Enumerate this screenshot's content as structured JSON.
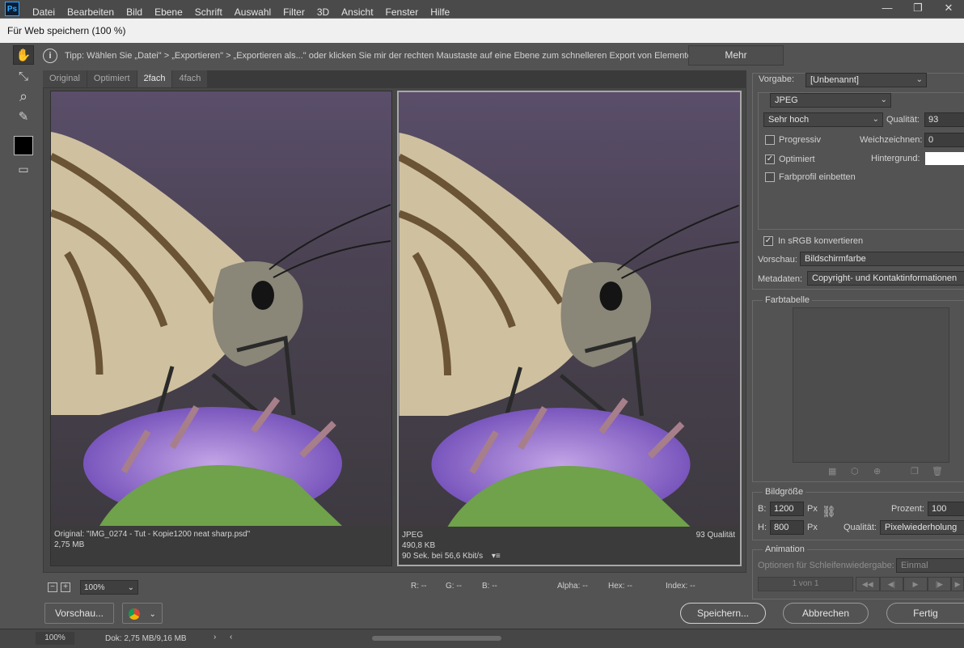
{
  "menubar": {
    "logo": "Ps",
    "items": [
      "Datei",
      "Bearbeiten",
      "Bild",
      "Ebene",
      "Schrift",
      "Auswahl",
      "Filter",
      "3D",
      "Ansicht",
      "Fenster",
      "Hilfe"
    ],
    "win_min": "—",
    "win_max": "❐",
    "win_close": "✕"
  },
  "dialog": {
    "title": "Für Web speichern (100 %)",
    "tip_icon": "i",
    "tip": "Tipp: Wählen Sie „Datei\" > „Exportieren\" > „Exportieren als...\" oder klicken Sie mir der rechten Maustaste auf eine Ebene zum schnelleren Export von Elementen",
    "mehr": "Mehr"
  },
  "tools": [
    {
      "name": "hand-tool-icon",
      "glyph": "✋"
    },
    {
      "name": "slice-select-tool-icon",
      "glyph": "⤡"
    },
    {
      "name": "zoom-tool-icon",
      "glyph": "⌕"
    },
    {
      "name": "eyedropper-tool-icon",
      "glyph": "✎"
    },
    {
      "name": "color-swatch",
      "glyph": ""
    },
    {
      "name": "toggle-slices-icon",
      "glyph": "▭"
    }
  ],
  "tabs": [
    "Original",
    "Optimiert",
    "2fach",
    "4fach"
  ],
  "active_tab": "2fach",
  "views": {
    "left": {
      "line1": "Original: \"IMG_0274 - Tut - Kopie1200 neat sharp.psd\"",
      "line2": "2,75 MB"
    },
    "right": {
      "line1": "JPEG",
      "line2": "490,8 KB",
      "line3": "90 Sek. bei 56,6 Kbit/s",
      "menu_glyph": "▾≡",
      "quality": "93 Qualität"
    }
  },
  "status": {
    "minus": "−",
    "plus": "+",
    "zoom": "100%",
    "r": "R: --",
    "g": "G: --",
    "b": "B: --",
    "alpha": "Alpha: --",
    "hex": "Hex: --",
    "index": "Index: --"
  },
  "bottom": {
    "preview": "Vorschau...",
    "save": "Speichern...",
    "cancel": "Abbrechen",
    "done": "Fertig"
  },
  "settings": {
    "preset_label": "Vorgabe:",
    "preset_value": "[Unbenannt]",
    "format": "JPEG",
    "quality_preset": "Sehr hoch",
    "quality_label": "Qualität:",
    "quality_value": "93",
    "progressive": "Progressiv",
    "blur_label": "Weichzeichnen:",
    "blur_value": "0",
    "optimized": "Optimiert",
    "matte_label": "Hintergrund:",
    "embed_profile": "Farbprofil einbetten",
    "srgb": "In sRGB konvertieren",
    "preview_label": "Vorschau:",
    "preview_value": "Bildschirmfarbe",
    "metadata_label": "Metadaten:",
    "metadata_value": "Copyright- und Kontaktinformationen"
  },
  "color_table": {
    "title": "Farbtabelle"
  },
  "image_size": {
    "title": "Bildgröße",
    "w_label": "B:",
    "w_value": "1200",
    "w_unit": "Px",
    "h_label": "H:",
    "h_value": "800",
    "h_unit": "Px",
    "percent_label": "Prozent:",
    "percent_value": "100",
    "quality_label": "Qualität:",
    "quality_value": "Pixelwiederholung"
  },
  "animation": {
    "title": "Animation",
    "loop_label": "Optionen für Schleifenwiedergabe:",
    "loop_value": "Einmal",
    "frame_counter": "1 von 1"
  },
  "ps_status": {
    "zoom": "100%",
    "doc": "Dok: 2,75 MB/9,16 MB"
  },
  "colors": {
    "background": "#535353",
    "accent": "#31a8ff"
  }
}
